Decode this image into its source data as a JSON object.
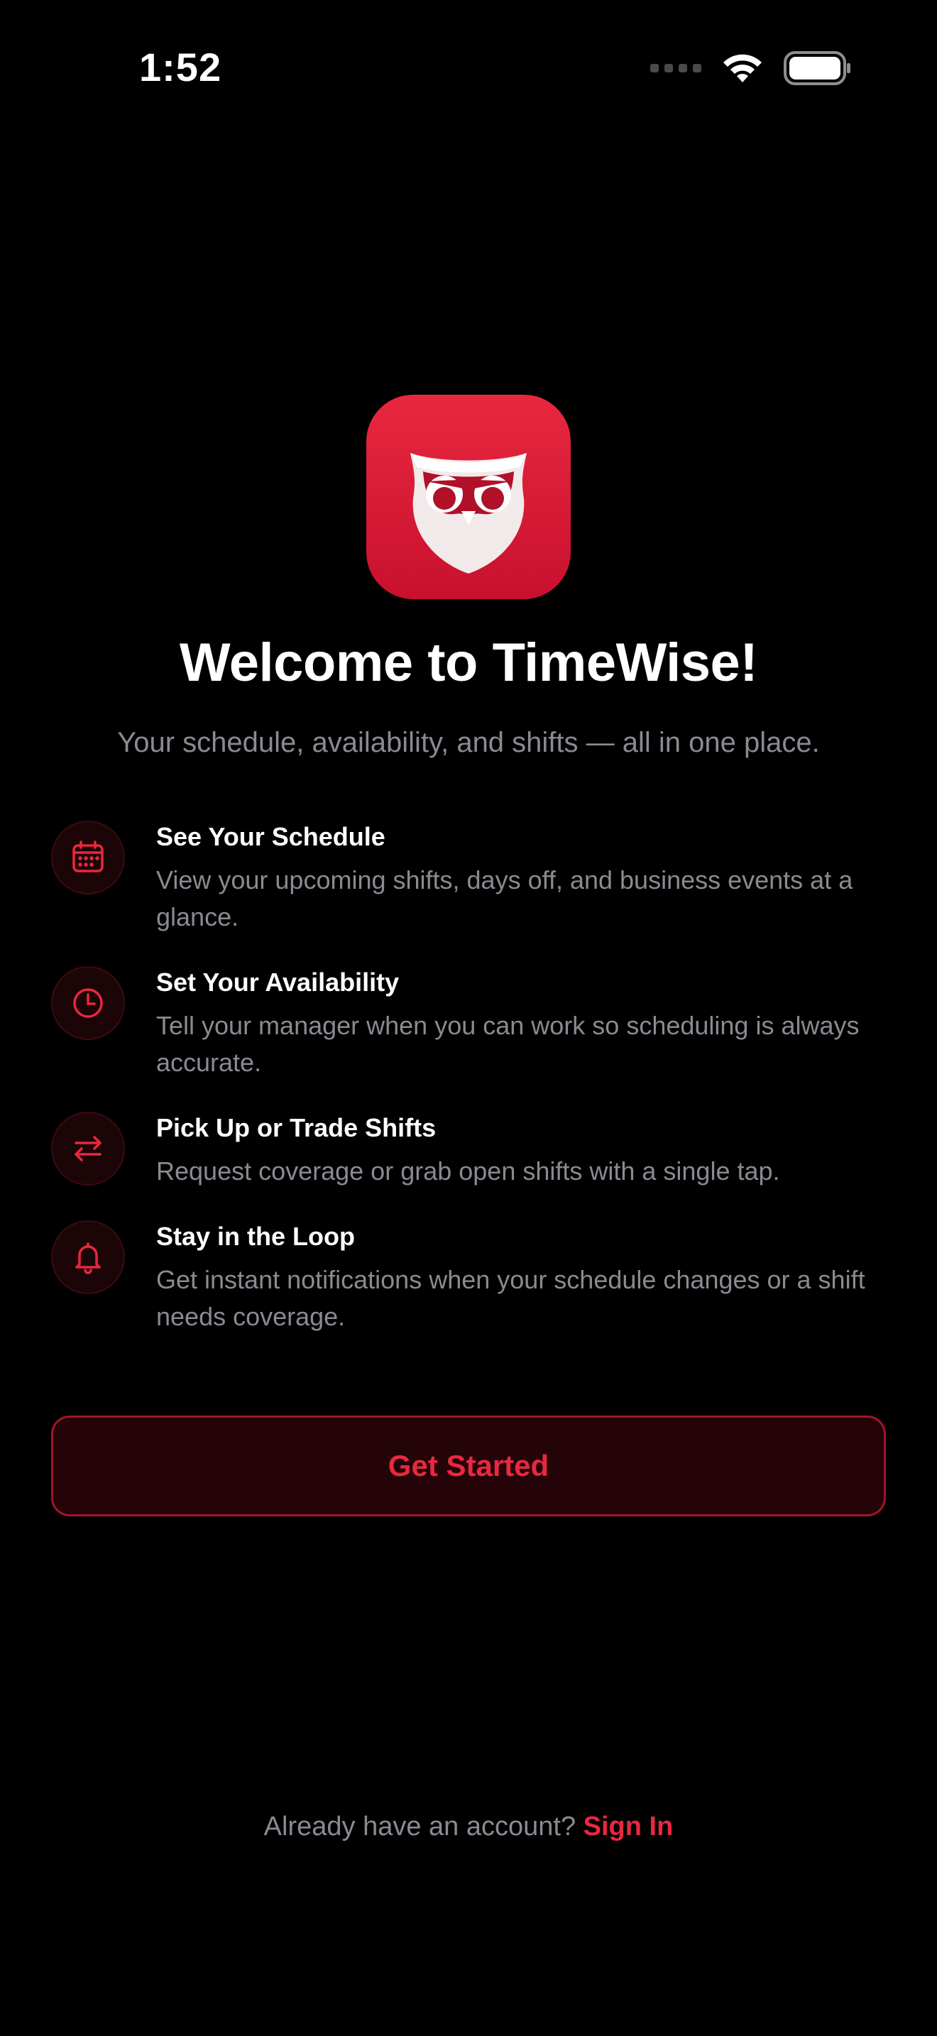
{
  "status_bar": {
    "time": "1:52"
  },
  "icons": {
    "wifi": "wifi-icon",
    "battery": "battery-icon",
    "cellular": "cellular-signal-icon",
    "app": "owl-logo-icon",
    "features": [
      "calendar-icon",
      "clock-icon",
      "swap-arrows-icon",
      "bell-icon"
    ]
  },
  "welcome": {
    "title": "Welcome to TimeWise!",
    "subtitle": "Your schedule, availability, and shifts — all in one place."
  },
  "features": [
    {
      "title": "See Your Schedule",
      "description": "View your upcoming shifts, days off, and business events at a glance."
    },
    {
      "title": "Set Your Availability",
      "description": "Tell your manager when you can work so scheduling is always accurate."
    },
    {
      "title": "Pick Up or Trade Shifts",
      "description": "Request coverage or grab open shifts with a single tap."
    },
    {
      "title": "Stay in the Loop",
      "description": "Get instant notifications when your schedule changes or a shift needs coverage."
    }
  ],
  "cta": {
    "label": "Get Started"
  },
  "signin": {
    "prompt": "Already have an account?",
    "link": "Sign In"
  },
  "colors": {
    "accent": "#E8283F",
    "background": "#000000",
    "muted_text": "#8A8A92"
  }
}
